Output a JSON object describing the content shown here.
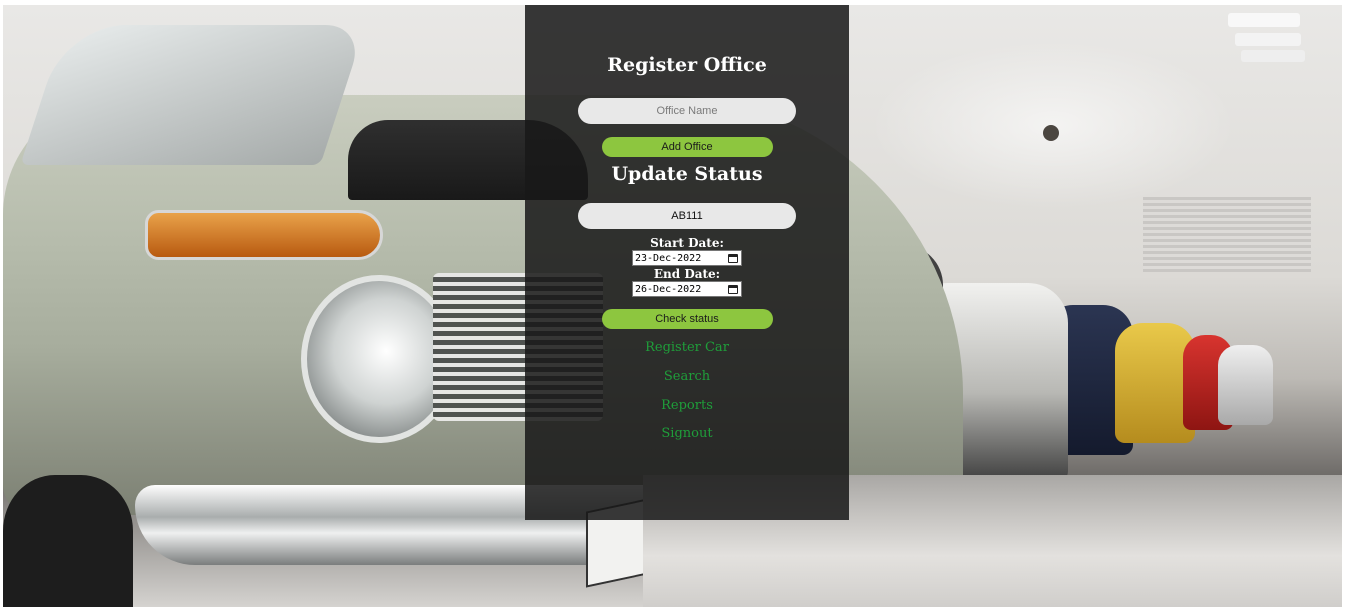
{
  "register_office": {
    "heading": "Register Office",
    "office_name_placeholder": "Office Name",
    "add_button_label": "Add Office"
  },
  "update_status": {
    "heading": "Update Status",
    "car_id_value": "AB111",
    "start_date_label": "Start Date:",
    "start_date_value": "23-Dec-2022",
    "end_date_label": "End Date:",
    "end_date_value": "26-Dec-2022",
    "check_button_label": "Check status"
  },
  "nav": {
    "register_car": "Register Car",
    "search": "Search",
    "reports": "Reports",
    "signout": "Signout"
  },
  "colors": {
    "panel": "#181818",
    "button": "#8dc63f",
    "link": "#1f9e3a"
  },
  "icons": {
    "date_picker": "calendar-icon"
  }
}
